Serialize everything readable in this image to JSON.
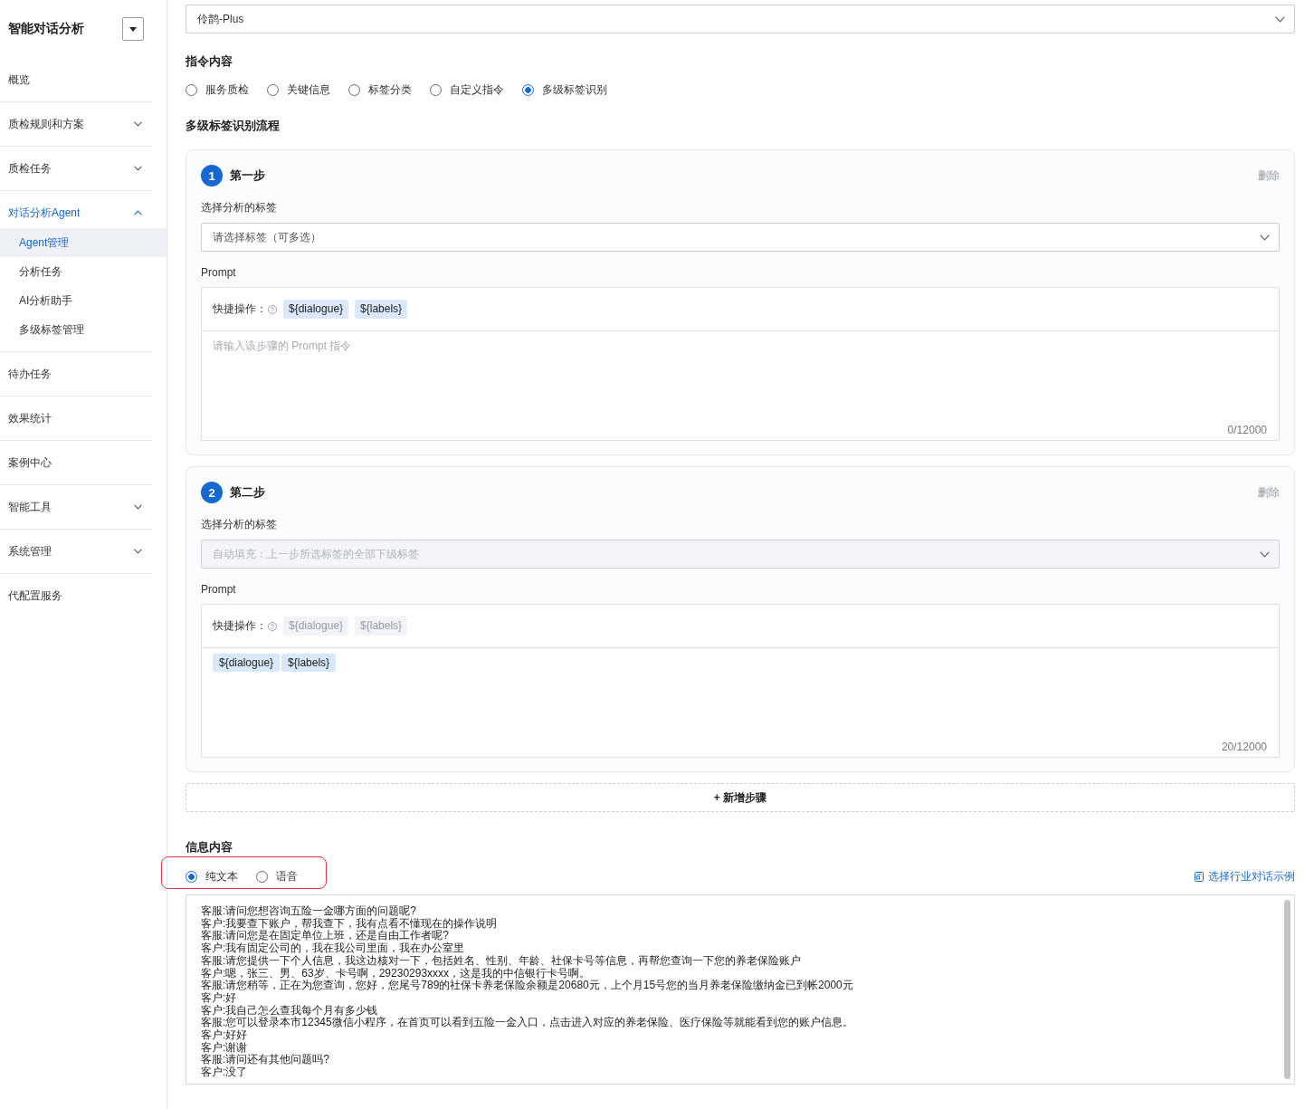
{
  "sidebar": {
    "title": "智能对话分析",
    "menu": [
      {
        "kind": "link",
        "label": "概览",
        "selected": false
      },
      {
        "kind": "group",
        "label": "质检规则和方案",
        "selected": false,
        "expanded": false
      },
      {
        "kind": "group",
        "label": "质检任务",
        "selected": false,
        "expanded": false
      },
      {
        "kind": "group",
        "label": "对话分析Agent",
        "selected": false,
        "expanded": true,
        "children": [
          {
            "label": "Agent管理",
            "selected": true
          },
          {
            "label": "分析任务",
            "selected": false
          },
          {
            "label": "AI分析助手",
            "selected": false
          },
          {
            "label": "多级标签管理",
            "selected": false
          }
        ]
      },
      {
        "kind": "link",
        "label": "待办任务",
        "selected": false
      },
      {
        "kind": "link",
        "label": "效果统计",
        "selected": false
      },
      {
        "kind": "link",
        "label": "案例中心",
        "selected": false
      },
      {
        "kind": "group",
        "label": "智能工具",
        "selected": false,
        "expanded": false
      },
      {
        "kind": "group",
        "label": "系统管理",
        "selected": false,
        "expanded": false
      },
      {
        "kind": "link",
        "label": "代配置服务",
        "selected": false
      }
    ]
  },
  "model_select": {
    "value": "伶鹊-Plus"
  },
  "instruction": {
    "title": "指令内容",
    "options": [
      {
        "label": "服务质检",
        "selected": false
      },
      {
        "label": "关键信息",
        "selected": false
      },
      {
        "label": "标签分类",
        "selected": false
      },
      {
        "label": "自定义指令",
        "selected": false
      },
      {
        "label": "多级标签识别",
        "selected": true
      }
    ]
  },
  "flow": {
    "title": "多级标签识别流程",
    "steps": [
      {
        "number": "1",
        "title": "第一步",
        "delete": "删除",
        "tag_label": "选择分析的标签",
        "tag_select": {
          "placeholder": "请选择标签（可多选）",
          "disabled": false
        },
        "prompt_label": "Prompt",
        "shortcut_label": "快捷操作：",
        "shortcuts": [
          {
            "label": "${dialogue}",
            "disabled": false
          },
          {
            "label": "${labels}",
            "disabled": false
          }
        ],
        "prompt": {
          "placeholder": "请输入该步骤的 Prompt 指令",
          "counter": "0/12000"
        }
      },
      {
        "number": "2",
        "title": "第二步",
        "delete": "删除",
        "tag_label": "选择分析的标签",
        "tag_select": {
          "placeholder": "自动填充：上一步所选标签的全部下级标签",
          "disabled": true
        },
        "prompt_label": "Prompt",
        "shortcut_label": "快捷操作：",
        "shortcuts": [
          {
            "label": "${dialogue}",
            "disabled": true
          },
          {
            "label": "${labels}",
            "disabled": true
          }
        ],
        "prompt": {
          "tokens": [
            "${dialogue}",
            "${labels}"
          ],
          "counter": "20/12000"
        }
      }
    ],
    "add_step": "+ 新增步骤"
  },
  "info": {
    "title": "信息内容",
    "highlighted": true,
    "options": [
      {
        "label": "纯文本",
        "selected": true
      },
      {
        "label": "语音",
        "selected": false
      }
    ],
    "example_link": "选择行业对话示例",
    "dialogue": [
      "客服:请问您想咨询五险一金哪方面的问题呢?",
      "客户:我要查下账户，帮我查下，我有点看不懂现在的操作说明",
      "客服:请问您是在固定单位上班，还是自由工作者呢?",
      "客户:我有固定公司的，我在我公司里面，我在办公室里",
      "客服:请您提供一下个人信息，我这边核对一下，包括姓名、性别、年龄、社保卡号等信息，再帮您查询一下您的养老保险账户",
      "客户:嗯，张三、男、63岁、卡号啊，29230293xxxx，这是我的中信银行卡号啊。",
      "客服:请您稍等，正在为您查询，您好，您尾号789的社保卡养老保险余额是20680元，上个月15号您的当月养老保险缴纳金已到帐2000元",
      "客户:好",
      "客户:我自己怎么查我每个月有多少钱",
      "客服:您可以登录本市12345微信小程序，在首页可以看到五险一金入口，点击进入对应的养老保险、医疗保险等就能看到您的账户信息。",
      "客户:好好",
      "客户:谢谢",
      "客服:请问还有其他问题吗?",
      "客户:没了"
    ]
  }
}
